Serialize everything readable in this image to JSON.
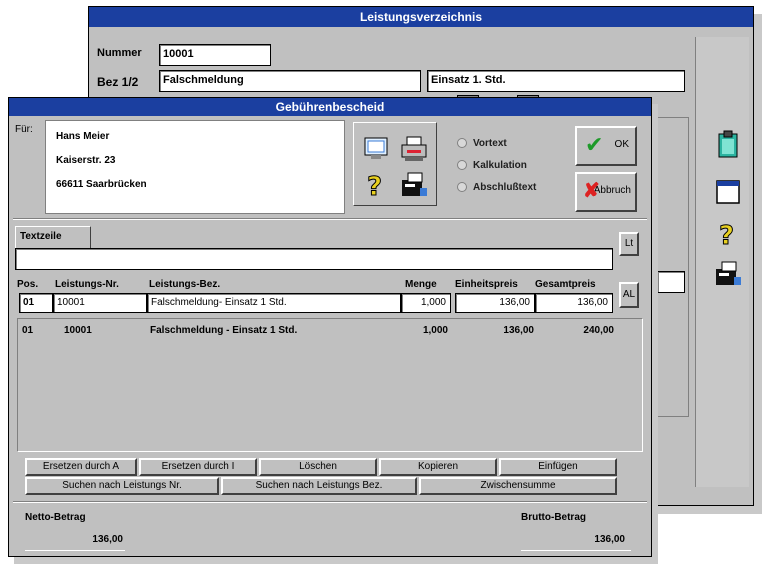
{
  "back": {
    "title": "Leistungsverzeichnis",
    "number_label": "Nummer",
    "number_value": "10001",
    "bez_label": "Bez 1/2",
    "bez1_value": "Falschmeldung",
    "bez2_value": "Einsatz 1. Std."
  },
  "dialog": {
    "title": "Gebührenbescheid",
    "for_label": "Für:",
    "address": [
      "Hans Meier",
      "Kaiserstr. 23",
      "66611 Saarbrücken"
    ],
    "options": [
      "Vortext",
      "Kalkulation",
      "Abschlußtext"
    ],
    "ok_label": "OK",
    "cancel_label": "Abbruch",
    "textzeile_tab": "Textzeile",
    "textzeile_value": "",
    "columns": {
      "pos": "Pos.",
      "nr": "Leistungs-Nr.",
      "bez": "Leistungs-Bez.",
      "menge": "Menge",
      "einzel": "Einheitspreis",
      "gesamt": "Gesamtpreis"
    },
    "edit_row": {
      "pos": "01",
      "nr": "10001",
      "bez": "Falschmeldung- Einsatz 1 Std.",
      "menge": "1,000",
      "einzel": "136,00",
      "gesamt": "136,00"
    },
    "rows": [
      {
        "pos": "01",
        "nr": "10001",
        "bez": "Falschmeldung - Einsatz 1 Std.",
        "menge": "1,000",
        "einzel": "136,00",
        "gesamt": "240,00"
      }
    ],
    "side_btn_top": "Lt",
    "side_btn_mid": "AL",
    "buttons_row1": [
      "Ersetzen durch A",
      "Ersetzen durch I",
      "Löschen",
      "Kopieren",
      "Einfügen"
    ],
    "buttons_row2": [
      "Suchen nach Leistungs Nr.",
      "Suchen nach Leistungs Bez.",
      "Zwischensumme"
    ],
    "netto_label": "Netto-Betrag",
    "netto_value": "136,00",
    "brutto_label": "Brutto-Betrag",
    "brutto_value": "136,00"
  },
  "icons": {
    "dialog_toolbar": [
      "monitor-icon",
      "printer-icon",
      "help-icon",
      "fax-icon"
    ],
    "right_toolbar": [
      "clipboard-icon",
      "window-icon",
      "help-icon",
      "fax-icon"
    ]
  }
}
